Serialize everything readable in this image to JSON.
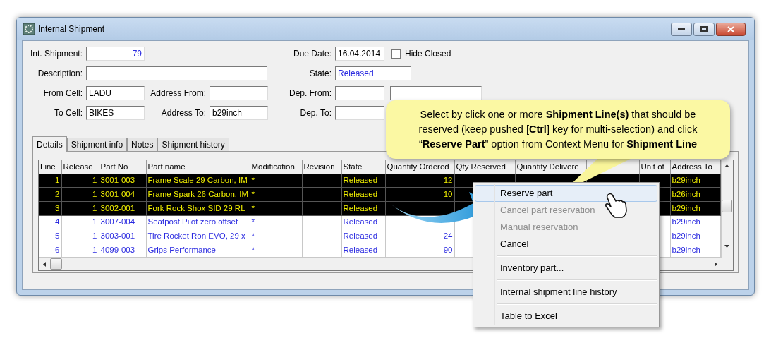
{
  "window": {
    "title": "Internal Shipment"
  },
  "form": {
    "rows": [
      {
        "left": {
          "label": "Int. Shipment:",
          "value": "79",
          "kind": "number",
          "emphasis": true
        },
        "right": {
          "label": "Due Date:",
          "value": "16.04.2014",
          "kind": "compact"
        }
      },
      {
        "left": {
          "label": "Description:",
          "kind": "long"
        },
        "right": {
          "label": "State:",
          "value": "Released",
          "kind": "medium",
          "emphasis": true
        }
      },
      {
        "left": {
          "label": "From Cell:",
          "value": "LADU",
          "kind": "short"
        },
        "middle": {
          "label": "Address From:",
          "kind": "short"
        },
        "right": {
          "label": "Dep. From:",
          "kind": "compact",
          "extra_field": true
        }
      },
      {
        "left": {
          "label": "To Cell:",
          "value": "BIKES",
          "kind": "short"
        },
        "middle": {
          "label": "Address To:",
          "value": "b29inch",
          "kind": "short"
        },
        "right": {
          "label": "Dep. To:",
          "kind": "compact"
        }
      }
    ],
    "hide_closed": {
      "label": "Hide Closed",
      "checked": false
    }
  },
  "tabs": [
    {
      "label": "Details",
      "selected": true
    },
    {
      "label": "Shipment info",
      "selected": false
    },
    {
      "label": "Notes",
      "selected": false
    },
    {
      "label": "Shipment history",
      "selected": false
    }
  ],
  "table": {
    "columns": [
      "Line",
      "Release",
      "Part No",
      "Part name",
      "Modification",
      "Revision",
      "State",
      "Quantity Ordered",
      "Qty Reserved",
      "Quantity Delivere",
      null,
      "Unit of",
      "Address To"
    ],
    "rows": [
      {
        "selected": true,
        "cells": [
          "1",
          "1",
          "3001-003",
          "Frame Scale 29 Carbon, IM",
          "*",
          null,
          "Released",
          "12",
          null,
          null,
          null,
          null,
          "b29inch"
        ]
      },
      {
        "selected": true,
        "cells": [
          "2",
          "1",
          "3001-004",
          "Frame Spark 26 Carbon, IM",
          "*",
          null,
          "Released",
          "10",
          null,
          null,
          null,
          null,
          "b26inch"
        ]
      },
      {
        "selected": true,
        "cells": [
          "3",
          "1",
          "3002-001",
          "Fork Rock Shox SID 29 RL",
          "*",
          null,
          "Released",
          null,
          null,
          null,
          null,
          null,
          "b29inch"
        ]
      },
      {
        "selected": false,
        "cells": [
          "4",
          "1",
          "3007-004",
          "Seatpost Pilot zero offset",
          "*",
          null,
          "Released",
          null,
          null,
          null,
          null,
          null,
          "b29inch"
        ]
      },
      {
        "selected": false,
        "cells": [
          "5",
          "1",
          "3003-001",
          "Tire Rocket Ron EVO, 29 x",
          "*",
          null,
          "Released",
          "24",
          null,
          null,
          null,
          null,
          "b29inch"
        ]
      },
      {
        "selected": false,
        "cells": [
          "6",
          "1",
          "4099-003",
          "Grips Performance",
          "*",
          null,
          "Released",
          "90",
          null,
          null,
          null,
          null,
          "b29inch"
        ]
      }
    ]
  },
  "context_menu": {
    "items": [
      {
        "label": "Reserve part",
        "selected": true,
        "disabled": false,
        "separator_before": false
      },
      {
        "label": "Cancel part reservation",
        "selected": false,
        "disabled": true,
        "separator_before": false
      },
      {
        "label": "Manual reservation",
        "selected": false,
        "disabled": true,
        "separator_before": false
      },
      {
        "label": "Cancel",
        "selected": false,
        "disabled": false,
        "separator_before": false
      },
      {
        "label": "Inventory part...",
        "selected": false,
        "disabled": false,
        "separator_before": true
      },
      {
        "label": "Internal shipment line history",
        "selected": false,
        "disabled": false,
        "separator_before": true
      },
      {
        "label": "Table to Excel",
        "selected": false,
        "disabled": false,
        "separator_before": true
      }
    ]
  },
  "callout": {
    "text": "Select by click one or more **Shipment Line(s)** that should be reserved (keep pushed [**Ctrl**] key for multi-selection) and click “**Reserve Part**” option from Context Menu for **Shipment Line**"
  }
}
